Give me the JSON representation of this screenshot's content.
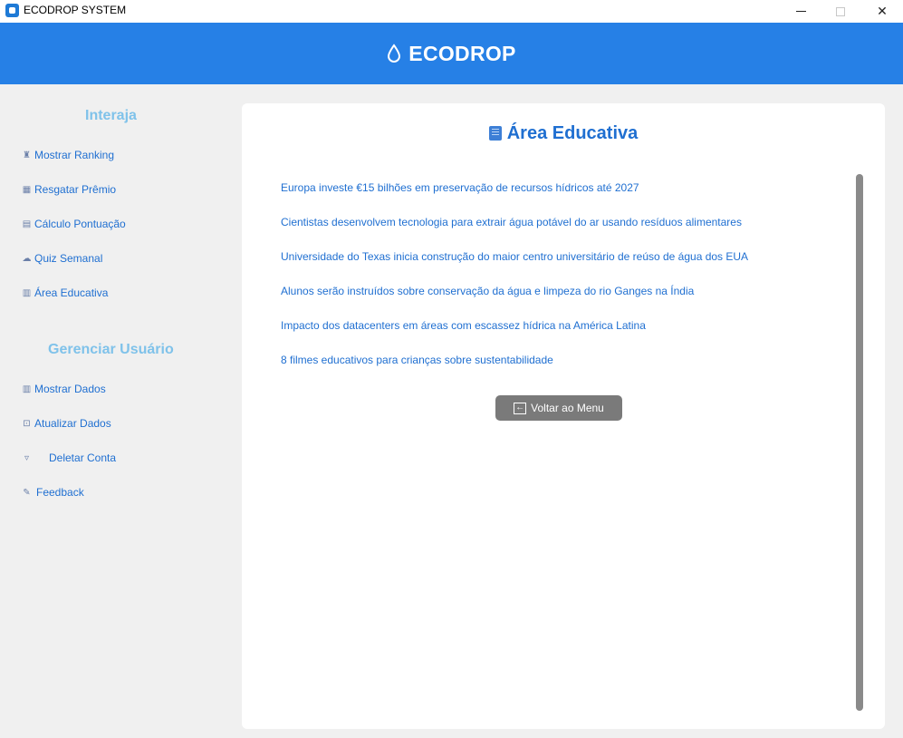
{
  "window": {
    "title": "ECODROP SYSTEM"
  },
  "header": {
    "brand": "ECODROP"
  },
  "sidebar": {
    "section_interaja": "Interaja",
    "section_gerenciar": "Gerenciar Usuário",
    "interaja_items": [
      {
        "label": "Mostrar Ranking",
        "icon": "trophy-icon"
      },
      {
        "label": "Resgatar Prêmio",
        "icon": "gift-icon"
      },
      {
        "label": "Cálculo Pontuação",
        "icon": "calculator-icon"
      },
      {
        "label": "Quiz Semanal",
        "icon": "brain-icon"
      },
      {
        "label": "Área Educativa",
        "icon": "book-icon"
      }
    ],
    "gerenciar_items": [
      {
        "label": "Mostrar Dados",
        "icon": "bar-chart-icon"
      },
      {
        "label": "Atualizar Dados",
        "icon": "refresh-icon"
      },
      {
        "label": "Deletar Conta",
        "icon": "trash-icon"
      },
      {
        "label": "Feedback",
        "icon": "pencil-icon"
      }
    ]
  },
  "main": {
    "title": "Área Educativa",
    "news": [
      "Europa investe €15 bilhões em preservação de recursos hídricos até 2027",
      "Cientistas desenvolvem tecnologia para extrair água potável do ar usando resíduos alimentares",
      "Universidade do Texas inicia construção do maior centro universitário de reúso de água dos EUA",
      "Alunos serão instruídos sobre conservação da água e limpeza do rio Ganges na Índia",
      "Impacto dos datacenters em áreas com escassez hídrica na América Latina",
      "8 filmes educativos para crianças sobre sustentabilidade"
    ],
    "back_button": "Voltar ao Menu"
  },
  "colors": {
    "header_bg": "#2680e6",
    "link": "#1f6fd1",
    "section_heading": "#7fc2ea",
    "button_bg": "#7a7a7a"
  }
}
